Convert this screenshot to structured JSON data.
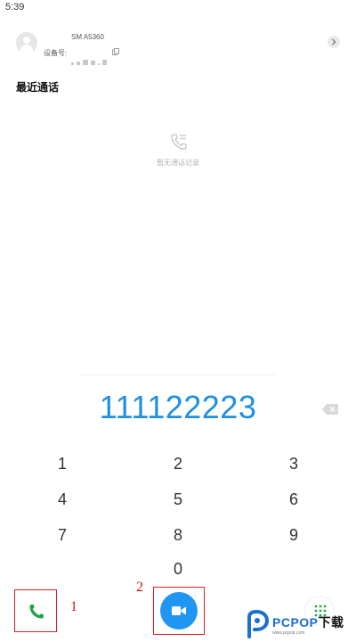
{
  "status_bar": {
    "time": "5:39"
  },
  "device": {
    "model": "SM A5360",
    "id_label": "设备号:"
  },
  "recent_calls": {
    "title": "最近通话",
    "empty_text": "暂无通话记录"
  },
  "dialer": {
    "number": "111122223",
    "keys": [
      "1",
      "2",
      "3",
      "4",
      "5",
      "6",
      "7",
      "8",
      "9",
      "0"
    ]
  },
  "annotations": {
    "call_label": "1",
    "video_label": "2"
  },
  "watermark": {
    "brand_main": "PCPOP",
    "brand_accent": "下载",
    "sub": "www.pcpop.com"
  },
  "colors": {
    "accent_blue": "#1e90e0",
    "call_green": "#1aa34a",
    "video_blue": "#2096f3",
    "annotation_red": "#d01818"
  }
}
